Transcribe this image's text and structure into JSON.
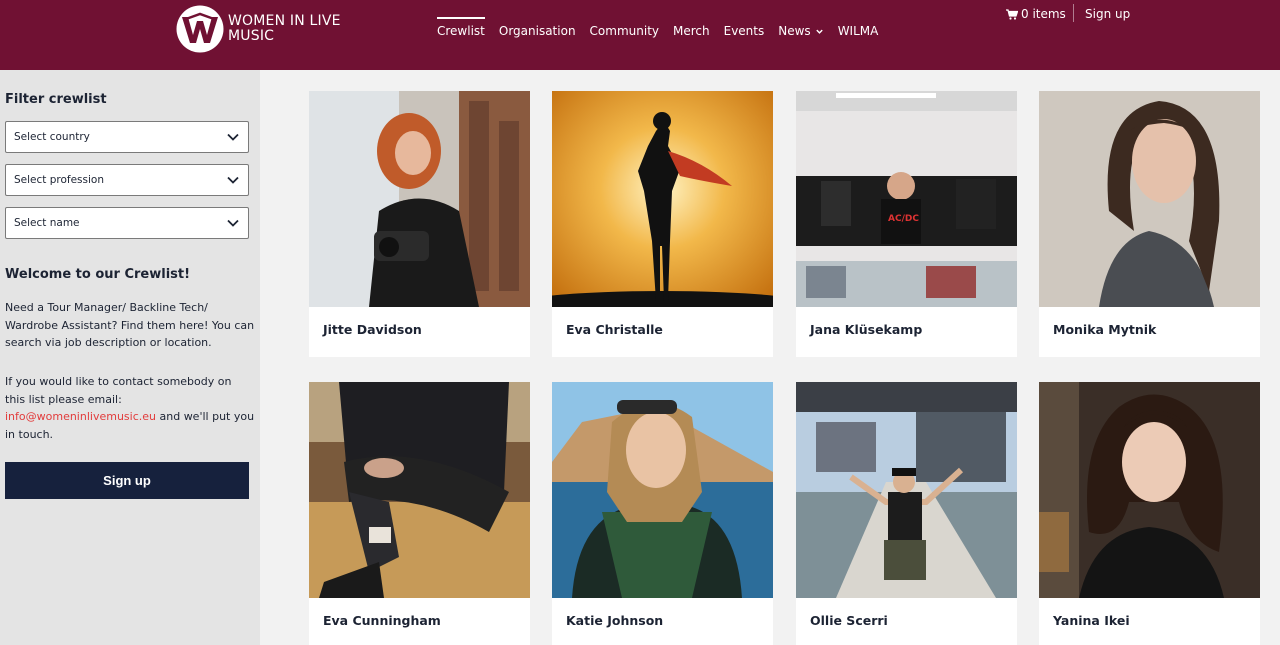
{
  "header": {
    "logo": {
      "line1": "WOMEN IN LIVE",
      "line2": "MUSIC"
    },
    "nav": [
      {
        "label": "Crewlist",
        "active": true
      },
      {
        "label": "Organisation"
      },
      {
        "label": "Community"
      },
      {
        "label": "Merch"
      },
      {
        "label": "Events"
      },
      {
        "label": "News",
        "dropdown": true
      },
      {
        "label": "WILMA"
      }
    ],
    "cart_label": "0 items",
    "signup_label": "Sign up"
  },
  "sidebar": {
    "filter_heading": "Filter crewlist",
    "selects": [
      {
        "value": "Select country"
      },
      {
        "value": "Select profession"
      },
      {
        "value": "Select name"
      }
    ],
    "welcome_heading": "Welcome to our Crewlist!",
    "intro": "Need a Tour Manager/ Backline Tech/ Wardrobe Assistant? Find them here! You can search via job description or location.",
    "contact_prefix": "If you would like to contact somebody on this list please email: ",
    "contact_email": "info@womeninlivemusic.eu",
    "contact_suffix": " and we'll put you in touch.",
    "signup_button": "Sign up"
  },
  "crew": [
    {
      "name": "Jitte Davidson",
      "photo": "woman-with-camera"
    },
    {
      "name": "Eva Christalle",
      "photo": "superhero-silhouette"
    },
    {
      "name": "Jana Klüsekamp",
      "photo": "woman-at-merch-stand"
    },
    {
      "name": "Monika Mytnik",
      "photo": "woman-portrait"
    },
    {
      "name": "Eva Cunningham",
      "photo": "seated-person-boots"
    },
    {
      "name": "Katie Johnson",
      "photo": "woman-by-sea"
    },
    {
      "name": "Ollie Scerri",
      "photo": "person-on-stage-pier"
    },
    {
      "name": "Yanina Ikei",
      "photo": "curly-hair-portrait"
    }
  ],
  "colors": {
    "header_bg": "#701133",
    "sidebar_bg": "#e4e4e4",
    "page_bg": "#f2f2f2",
    "button_bg": "#16213d",
    "link": "#e23c3c",
    "text": "#1c2333"
  }
}
